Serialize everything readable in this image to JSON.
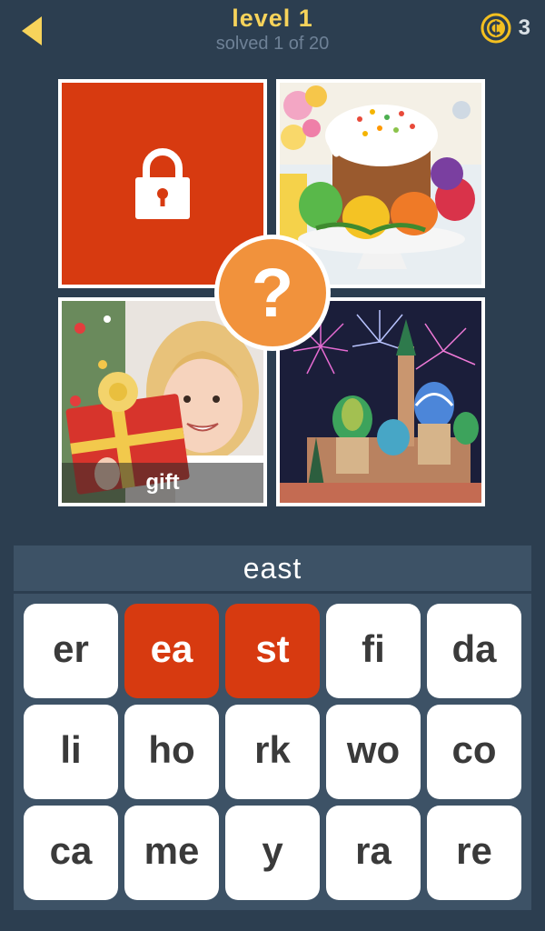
{
  "header": {
    "level_title": "level 1",
    "progress": "solved 1 of 20",
    "coins": "3"
  },
  "tiles": [
    {
      "state": "locked",
      "icon": "lock-icon"
    },
    {
      "state": "revealed",
      "subject": "easter cake with eggs"
    },
    {
      "state": "revealed",
      "subject": "girl with gift",
      "hint_word": "gift"
    },
    {
      "state": "revealed",
      "subject": "fireworks over cathedral"
    }
  ],
  "question_mark": "?",
  "answer": "east",
  "letter_tiles": [
    {
      "text": "er",
      "selected": false
    },
    {
      "text": "ea",
      "selected": true
    },
    {
      "text": "st",
      "selected": true
    },
    {
      "text": "fi",
      "selected": false
    },
    {
      "text": "da",
      "selected": false
    },
    {
      "text": "li",
      "selected": false
    },
    {
      "text": "ho",
      "selected": false
    },
    {
      "text": "rk",
      "selected": false
    },
    {
      "text": "wo",
      "selected": false
    },
    {
      "text": "co",
      "selected": false
    },
    {
      "text": "ca",
      "selected": false
    },
    {
      "text": "me",
      "selected": false
    },
    {
      "text": "y",
      "selected": false
    },
    {
      "text": "ra",
      "selected": false
    },
    {
      "text": "re",
      "selected": false
    }
  ],
  "colors": {
    "background": "#2c3e50",
    "panel": "#3d5266",
    "accent_red": "#d73a10",
    "accent_orange": "#f1923c",
    "title_yellow": "#f7d35b"
  }
}
